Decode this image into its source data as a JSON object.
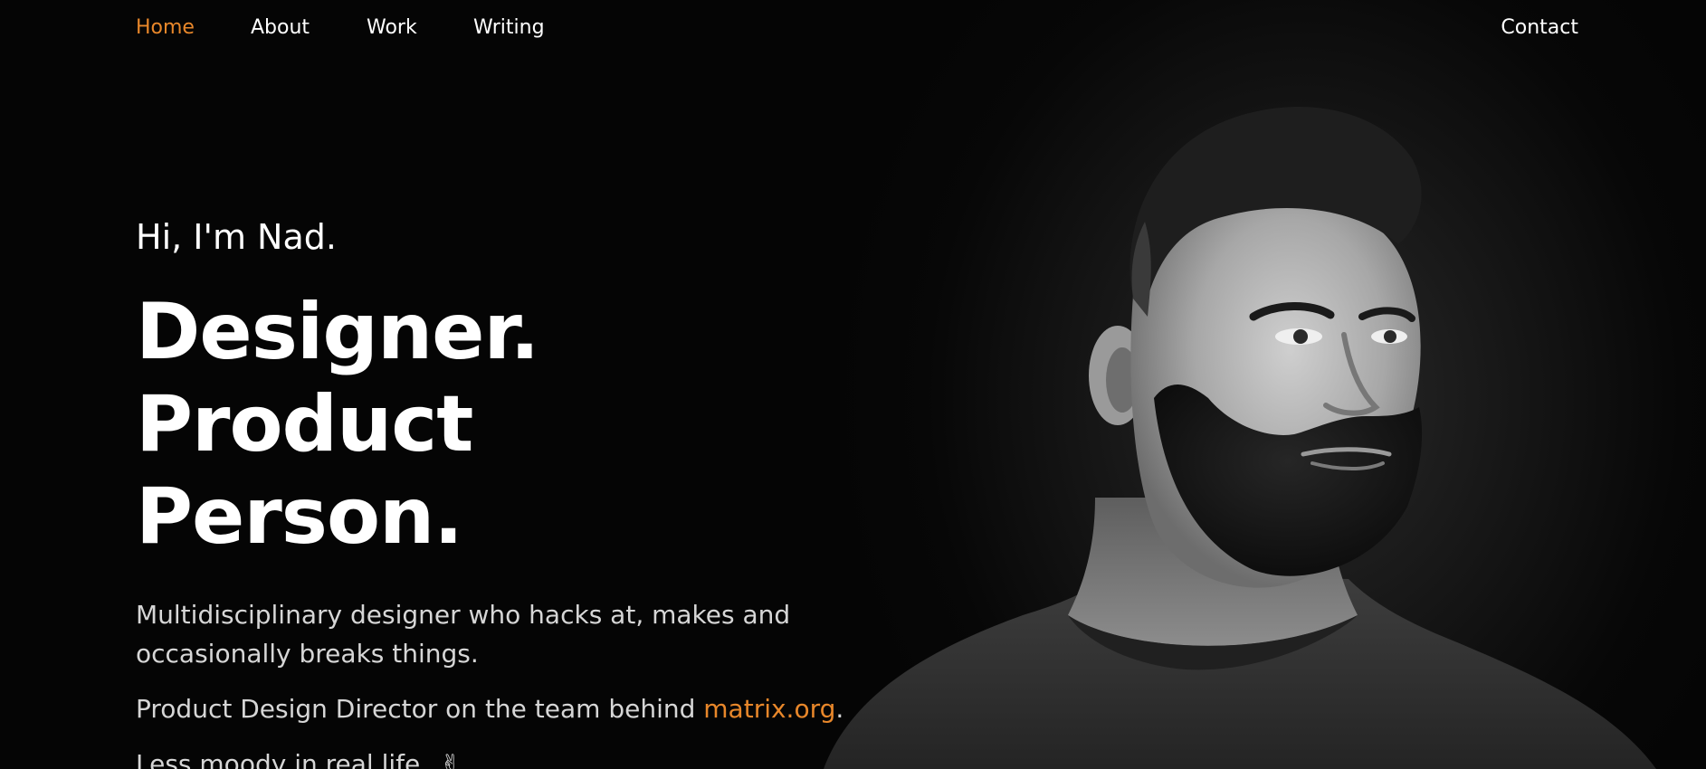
{
  "nav": {
    "items": [
      {
        "label": "Home",
        "active": true
      },
      {
        "label": "About",
        "active": false
      },
      {
        "label": "Work",
        "active": false
      },
      {
        "label": "Writing",
        "active": false
      }
    ],
    "contact_label": "Contact"
  },
  "hero": {
    "greeting": "Hi, I'm Nad.",
    "headline_line1": "Designer. Product",
    "headline_line2": "Person.",
    "intro": "Multidisciplinary designer who hacks at, makes and occasionally breaks things.",
    "role_text": "Product Design Director on the team behind ",
    "role_link": "matrix.org",
    "role_suffix": ".",
    "mood_text": "Less moody in real life.",
    "mood_emoji": "✌"
  },
  "portrait": {
    "icon": "portrait-photo",
    "style": "black-and-white"
  },
  "colors": {
    "accent": "#e8872a",
    "background": "#050505",
    "text": "#ffffff",
    "body_text": "#d6d6d6"
  }
}
